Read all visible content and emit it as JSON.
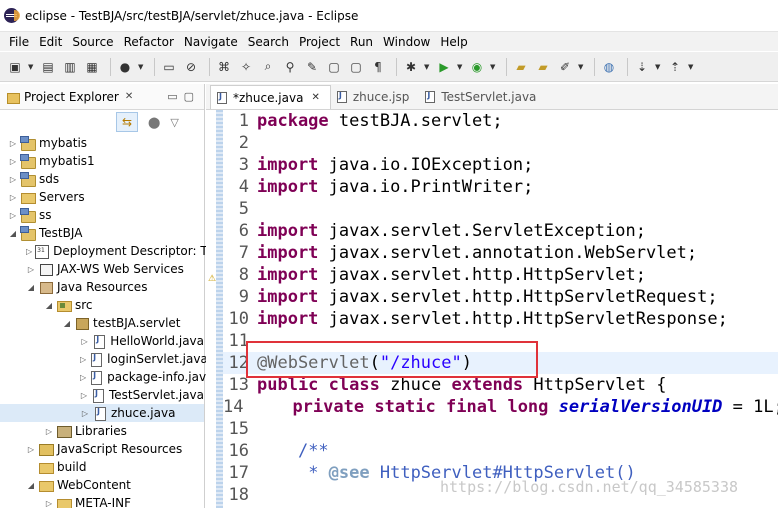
{
  "window": {
    "title": "eclipse - TestBJA/src/testBJA/servlet/zhuce.java - Eclipse"
  },
  "menu": [
    "File",
    "Edit",
    "Source",
    "Refactor",
    "Navigate",
    "Search",
    "Project",
    "Run",
    "Window",
    "Help"
  ],
  "project_explorer": {
    "tab_label": "Project Explorer",
    "tree": [
      {
        "label": "mybatis",
        "indent": 0,
        "expand": "right",
        "icon": "proj"
      },
      {
        "label": "mybatis1",
        "indent": 0,
        "expand": "right",
        "icon": "proj"
      },
      {
        "label": "sds",
        "indent": 0,
        "expand": "right",
        "icon": "proj"
      },
      {
        "label": "Servers",
        "indent": 0,
        "expand": "right",
        "icon": "folder"
      },
      {
        "label": "ss",
        "indent": 0,
        "expand": "right",
        "icon": "proj"
      },
      {
        "label": "TestBJA",
        "indent": 0,
        "expand": "down",
        "icon": "proj"
      },
      {
        "label": "Deployment Descriptor: T",
        "indent": 1,
        "expand": "right",
        "icon": "dd"
      },
      {
        "label": "JAX-WS Web Services",
        "indent": 1,
        "expand": "right",
        "icon": "ws"
      },
      {
        "label": "Java Resources",
        "indent": 1,
        "expand": "down",
        "icon": "jar"
      },
      {
        "label": "src",
        "indent": 2,
        "expand": "down",
        "icon": "src"
      },
      {
        "label": "testBJA.servlet",
        "indent": 3,
        "expand": "down",
        "icon": "pkg"
      },
      {
        "label": "HelloWorld.java",
        "indent": 4,
        "expand": "right",
        "icon": "file"
      },
      {
        "label": "loginServlet.java",
        "indent": 4,
        "expand": "right",
        "icon": "file"
      },
      {
        "label": "package-info.java",
        "indent": 4,
        "expand": "right",
        "icon": "file"
      },
      {
        "label": "TestServlet.java",
        "indent": 4,
        "expand": "right",
        "icon": "file"
      },
      {
        "label": "zhuce.java",
        "indent": 4,
        "expand": "right",
        "icon": "file",
        "selected": true
      },
      {
        "label": "Libraries",
        "indent": 2,
        "expand": "right",
        "icon": "lib"
      },
      {
        "label": "JavaScript Resources",
        "indent": 1,
        "expand": "right",
        "icon": "jsr"
      },
      {
        "label": "build",
        "indent": 1,
        "expand": "none",
        "icon": "folder"
      },
      {
        "label": "WebContent",
        "indent": 1,
        "expand": "down",
        "icon": "folder"
      },
      {
        "label": "META-INF",
        "indent": 2,
        "expand": "right",
        "icon": "folder"
      }
    ]
  },
  "editor": {
    "tabs": [
      {
        "label": "*zhuce.java",
        "active": true
      },
      {
        "label": "zhuce.jsp",
        "active": false
      },
      {
        "label": "TestServlet.java",
        "active": false
      }
    ],
    "lines": [
      {
        "n": "1",
        "parts": [
          [
            "kw",
            "package"
          ],
          [
            "t",
            " testBJA.servlet;"
          ]
        ]
      },
      {
        "n": "2",
        "parts": []
      },
      {
        "n": "3",
        "parts": [
          [
            "kw",
            "import"
          ],
          [
            "t",
            " java.io.IOException;"
          ]
        ]
      },
      {
        "n": "4",
        "parts": [
          [
            "kw",
            "import"
          ],
          [
            "t",
            " java.io.PrintWriter;"
          ]
        ]
      },
      {
        "n": "5",
        "parts": []
      },
      {
        "n": "6",
        "parts": [
          [
            "kw",
            "import"
          ],
          [
            "t",
            " javax.servlet.ServletException;"
          ]
        ]
      },
      {
        "n": "7",
        "parts": [
          [
            "kw",
            "import"
          ],
          [
            "t",
            " javax.servlet.annotation.WebServlet;"
          ]
        ]
      },
      {
        "n": "8",
        "parts": [
          [
            "kw",
            "import"
          ],
          [
            "t",
            " javax.servlet.http.HttpServlet;"
          ]
        ]
      },
      {
        "n": "9",
        "parts": [
          [
            "kw",
            "import"
          ],
          [
            "t",
            " javax.servlet.http.HttpServletRequest;"
          ]
        ]
      },
      {
        "n": "10",
        "parts": [
          [
            "kw",
            "import"
          ],
          [
            "t",
            " javax.servlet.http.HttpServletResponse;"
          ]
        ]
      },
      {
        "n": "11",
        "parts": []
      },
      {
        "n": "12",
        "parts": [
          [
            "ann",
            "@WebServlet"
          ],
          [
            "t",
            "("
          ],
          [
            "str",
            "\"/zhuce\""
          ],
          [
            "t",
            ")"
          ]
        ],
        "current": true
      },
      {
        "n": "13",
        "parts": [
          [
            "kw",
            "public"
          ],
          [
            "t",
            " "
          ],
          [
            "kw",
            "class"
          ],
          [
            "t",
            " zhuce "
          ],
          [
            "kw",
            "extends"
          ],
          [
            "t",
            " HttpServlet {"
          ]
        ]
      },
      {
        "n": "14",
        "parts": [
          [
            "t",
            "    "
          ],
          [
            "kw",
            "private"
          ],
          [
            "t",
            " "
          ],
          [
            "kw",
            "static"
          ],
          [
            "t",
            " "
          ],
          [
            "kw",
            "final"
          ],
          [
            "t",
            " "
          ],
          [
            "kw",
            "long"
          ],
          [
            "t",
            " "
          ],
          [
            "field",
            "serialVersionUID"
          ],
          [
            "t",
            " = 1L;"
          ]
        ]
      },
      {
        "n": "15",
        "parts": []
      },
      {
        "n": "16",
        "parts": [
          [
            "t",
            "    "
          ],
          [
            "doc",
            "/**"
          ]
        ]
      },
      {
        "n": "17",
        "parts": [
          [
            "t",
            "     "
          ],
          [
            "doc",
            "* "
          ],
          [
            "doc-kw",
            "@see"
          ],
          [
            "doc",
            " HttpServlet#HttpServlet()"
          ]
        ]
      },
      {
        "n": "18",
        "parts": []
      }
    ]
  },
  "watermark": "https://blog.csdn.net/qq_34585338"
}
